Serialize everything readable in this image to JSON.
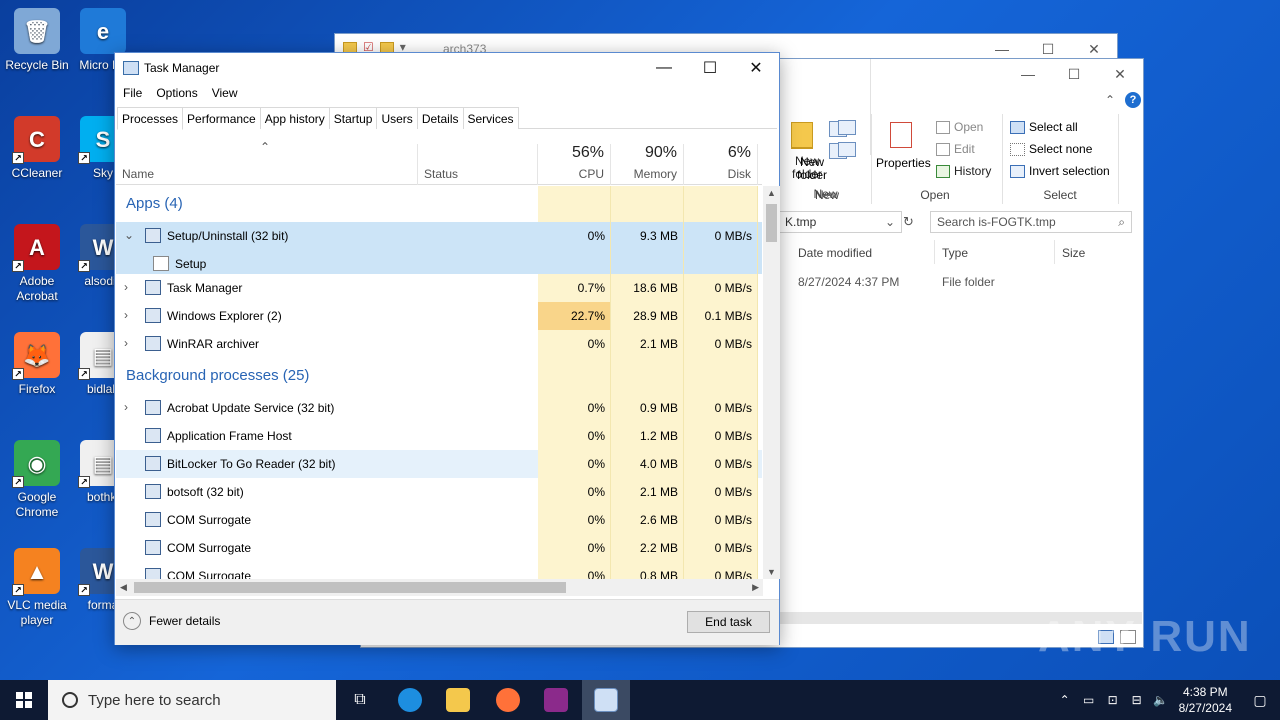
{
  "desktop": {
    "icons": [
      {
        "label": "Recycle Bin",
        "color": "#7fa8d6",
        "glyph": "🗑"
      },
      {
        "label": "CCleaner",
        "color": "#d23a2a",
        "glyph": "C"
      },
      {
        "label": "Adobe Acrobat",
        "color": "#c4161c",
        "glyph": "A"
      },
      {
        "label": "Firefox",
        "color": "#ff7139",
        "glyph": "🦊"
      },
      {
        "label": "Google Chrome",
        "color": "#34a853",
        "glyph": "◉"
      },
      {
        "label": "VLC media player",
        "color": "#f58220",
        "glyph": "▲"
      }
    ],
    "icons_col2": [
      {
        "label": "Micro Ed",
        "color": "#1f7ad8",
        "glyph": "e"
      },
      {
        "label": "Sky",
        "color": "#00aff0",
        "glyph": "S"
      },
      {
        "label": "alsodis",
        "color": "#2b579a",
        "glyph": "W"
      },
      {
        "label": "bidlab",
        "color": "#f0f0f0",
        "glyph": "▤"
      },
      {
        "label": "bothki",
        "color": "#f0f0f0",
        "glyph": "▤"
      },
      {
        "label": "forma",
        "color": "#2b579a",
        "glyph": "W"
      }
    ]
  },
  "explorer_back": {
    "title": "arch373"
  },
  "explorer": {
    "ribbon": {
      "new_folder": "New folder",
      "group_new": "New",
      "properties": "Properties",
      "open": "Open",
      "edit": "Edit",
      "history": "History",
      "group_open": "Open",
      "select_all": "Select all",
      "select_none": "Select none",
      "invert_selection": "Invert selection",
      "group_select": "Select"
    },
    "address_tail": "K.tmp",
    "search_placeholder": "Search is-FOGTK.tmp",
    "columns": {
      "date": "Date modified",
      "type": "Type",
      "size": "Size"
    },
    "row": {
      "date": "8/27/2024 4:37 PM",
      "type": "File folder"
    }
  },
  "taskmanager": {
    "title": "Task Manager",
    "menu": [
      "File",
      "Options",
      "View"
    ],
    "tabs": [
      "Processes",
      "Performance",
      "App history",
      "Startup",
      "Users",
      "Details",
      "Services"
    ],
    "headers": {
      "name": "Name",
      "status": "Status",
      "cpu_pct": "56%",
      "cpu": "CPU",
      "mem_pct": "90%",
      "mem": "Memory",
      "disk_pct": "6%",
      "disk": "Disk"
    },
    "apps_group": "Apps (4)",
    "bg_group": "Background processes (25)",
    "apps": [
      {
        "name": "Setup/Uninstall (32 bit)",
        "cpu": "0%",
        "mem": "9.3 MB",
        "disk": "0 MB/s",
        "expanded": true,
        "child": "Setup"
      },
      {
        "name": "Task Manager",
        "cpu": "0.7%",
        "mem": "18.6 MB",
        "disk": "0 MB/s"
      },
      {
        "name": "Windows Explorer (2)",
        "cpu": "22.7%",
        "mem": "28.9 MB",
        "disk": "0.1 MB/s"
      },
      {
        "name": "WinRAR archiver",
        "cpu": "0%",
        "mem": "2.1 MB",
        "disk": "0 MB/s"
      }
    ],
    "background": [
      {
        "name": "Acrobat Update Service (32 bit)",
        "cpu": "0%",
        "mem": "0.9 MB",
        "disk": "0 MB/s",
        "expand": true
      },
      {
        "name": "Application Frame Host",
        "cpu": "0%",
        "mem": "1.2 MB",
        "disk": "0 MB/s"
      },
      {
        "name": "BitLocker To Go Reader (32 bit)",
        "cpu": "0%",
        "mem": "4.0 MB",
        "disk": "0 MB/s"
      },
      {
        "name": "botsoft (32 bit)",
        "cpu": "0%",
        "mem": "2.1 MB",
        "disk": "0 MB/s"
      },
      {
        "name": "COM Surrogate",
        "cpu": "0%",
        "mem": "2.6 MB",
        "disk": "0 MB/s"
      },
      {
        "name": "COM Surrogate",
        "cpu": "0%",
        "mem": "2.2 MB",
        "disk": "0 MB/s"
      },
      {
        "name": "COM Surrogate",
        "cpu": "0%",
        "mem": "0.8 MB",
        "disk": "0 MB/s"
      }
    ],
    "fewer_details": "Fewer details",
    "end_task": "End task"
  },
  "taskbar": {
    "search_placeholder": "Type here to search",
    "time": "4:38 PM",
    "date": "8/27/2024"
  },
  "watermark": "ANY RUN",
  "colors": {
    "cpu_hot": "#f9d58a",
    "col_tint": "#fdf4cf",
    "selection": "#cce4f7",
    "group_text": "#2864b4"
  }
}
